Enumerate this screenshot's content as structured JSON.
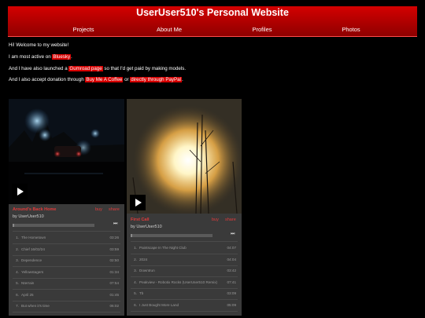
{
  "site": {
    "title": "UserUser510's Personal Website",
    "nav": [
      "Projects",
      "About Me",
      "Profiles",
      "Photos"
    ]
  },
  "intro": {
    "line1": "Hi! Welcome to my website!",
    "line2_pre": "I am most active on ",
    "line2_link": "Bluesky",
    "line2_post": ".",
    "line3_pre": "And I have also launched a ",
    "line3_link": "Gumroad page",
    "line3_post": " so that I'd get paid by making models.",
    "line4_pre": "And I also accept donation through ",
    "line4_link1": "Buy Me A Coffee",
    "line4_mid": " or ",
    "line4_link2": "directly through PayPal",
    "line4_post": "."
  },
  "players": [
    {
      "album": "Around's Back Home",
      "by": "by UserUser510",
      "buy": "buy",
      "share": "share",
      "progress": 0.0,
      "tracks": [
        {
          "n": "1.",
          "title": "The Hometown",
          "dur": "03:26"
        },
        {
          "n": "2.",
          "title": "Chief 16/02/24",
          "dur": "03:59"
        },
        {
          "n": "3.",
          "title": "Dependence",
          "dur": "02:50"
        },
        {
          "n": "4.",
          "title": "Yellowstagers",
          "dur": "01:34"
        },
        {
          "n": "5.",
          "title": "Nterrain",
          "dur": "07:54"
        },
        {
          "n": "6.",
          "title": "April 25",
          "dur": "01:45"
        },
        {
          "n": "7.",
          "title": "But when it's time",
          "dur": "06:02"
        }
      ]
    },
    {
      "album": "First Call",
      "by": "by UserUser510",
      "buy": "buy",
      "share": "share",
      "progress": 0.0,
      "tracks": [
        {
          "n": "1.",
          "title": "Paintscape In The Night Club",
          "dur": "04:07"
        },
        {
          "n": "2.",
          "title": "2024",
          "dur": "04:04"
        },
        {
          "n": "3.",
          "title": "Downtrun",
          "dur": "03:42"
        },
        {
          "n": "4.",
          "title": "Peakview - Robotix Rocks (UserUser510 Remix)",
          "dur": "07:41"
        },
        {
          "n": "5.",
          "title": "Tb",
          "dur": "03:09"
        },
        {
          "n": "6.",
          "title": "I Just Bought More Land",
          "dur": "05:09"
        }
      ]
    }
  ],
  "colors": {
    "accent": "#d60000",
    "banner_top": "#d40000",
    "banner_bottom": "#8e0000",
    "player_bg": "#3a3a3a",
    "link_red": "#e23b3b"
  },
  "icons": {
    "play": "play-icon",
    "next": "skip-next-icon"
  }
}
